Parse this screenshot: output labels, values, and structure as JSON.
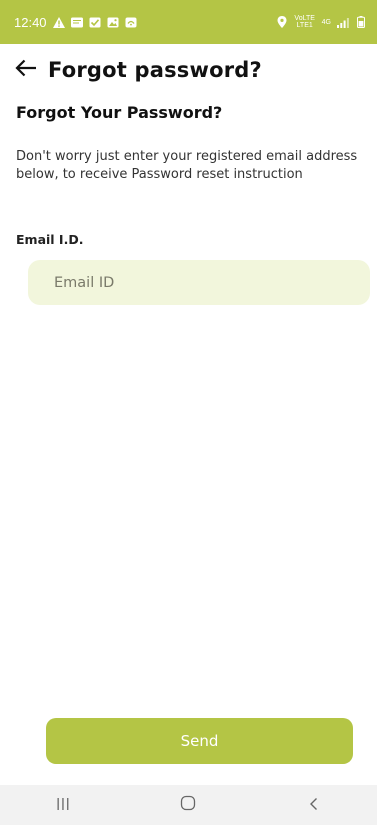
{
  "status_bar": {
    "time": "12:40",
    "left_icons": [
      "warning-icon",
      "message-icon",
      "checkbox-icon",
      "image-icon",
      "app-icon"
    ],
    "right_icons": [
      "location-icon",
      "volte-icon",
      "network-4g-icon",
      "signal-icon",
      "battery-icon"
    ],
    "volte_label": "VoLTE LTE1",
    "network_label": "4G",
    "background_color": "#b4c545"
  },
  "header": {
    "back_icon": "arrow-left-icon",
    "title": "Forgot password?"
  },
  "content": {
    "section_title": "Forgot Your Password?",
    "description": "Don't worry just enter your registered email address below, to receive Password reset instruction",
    "email_label": "Email I.D.",
    "email_placeholder": "Email ID",
    "email_value": "",
    "field_color": "#f2f6dc"
  },
  "actions": {
    "send_label": "Send",
    "accent_color": "#b4c545"
  },
  "nav_bar": {
    "items": [
      "recent-apps-icon",
      "home-icon",
      "back-icon"
    ]
  }
}
